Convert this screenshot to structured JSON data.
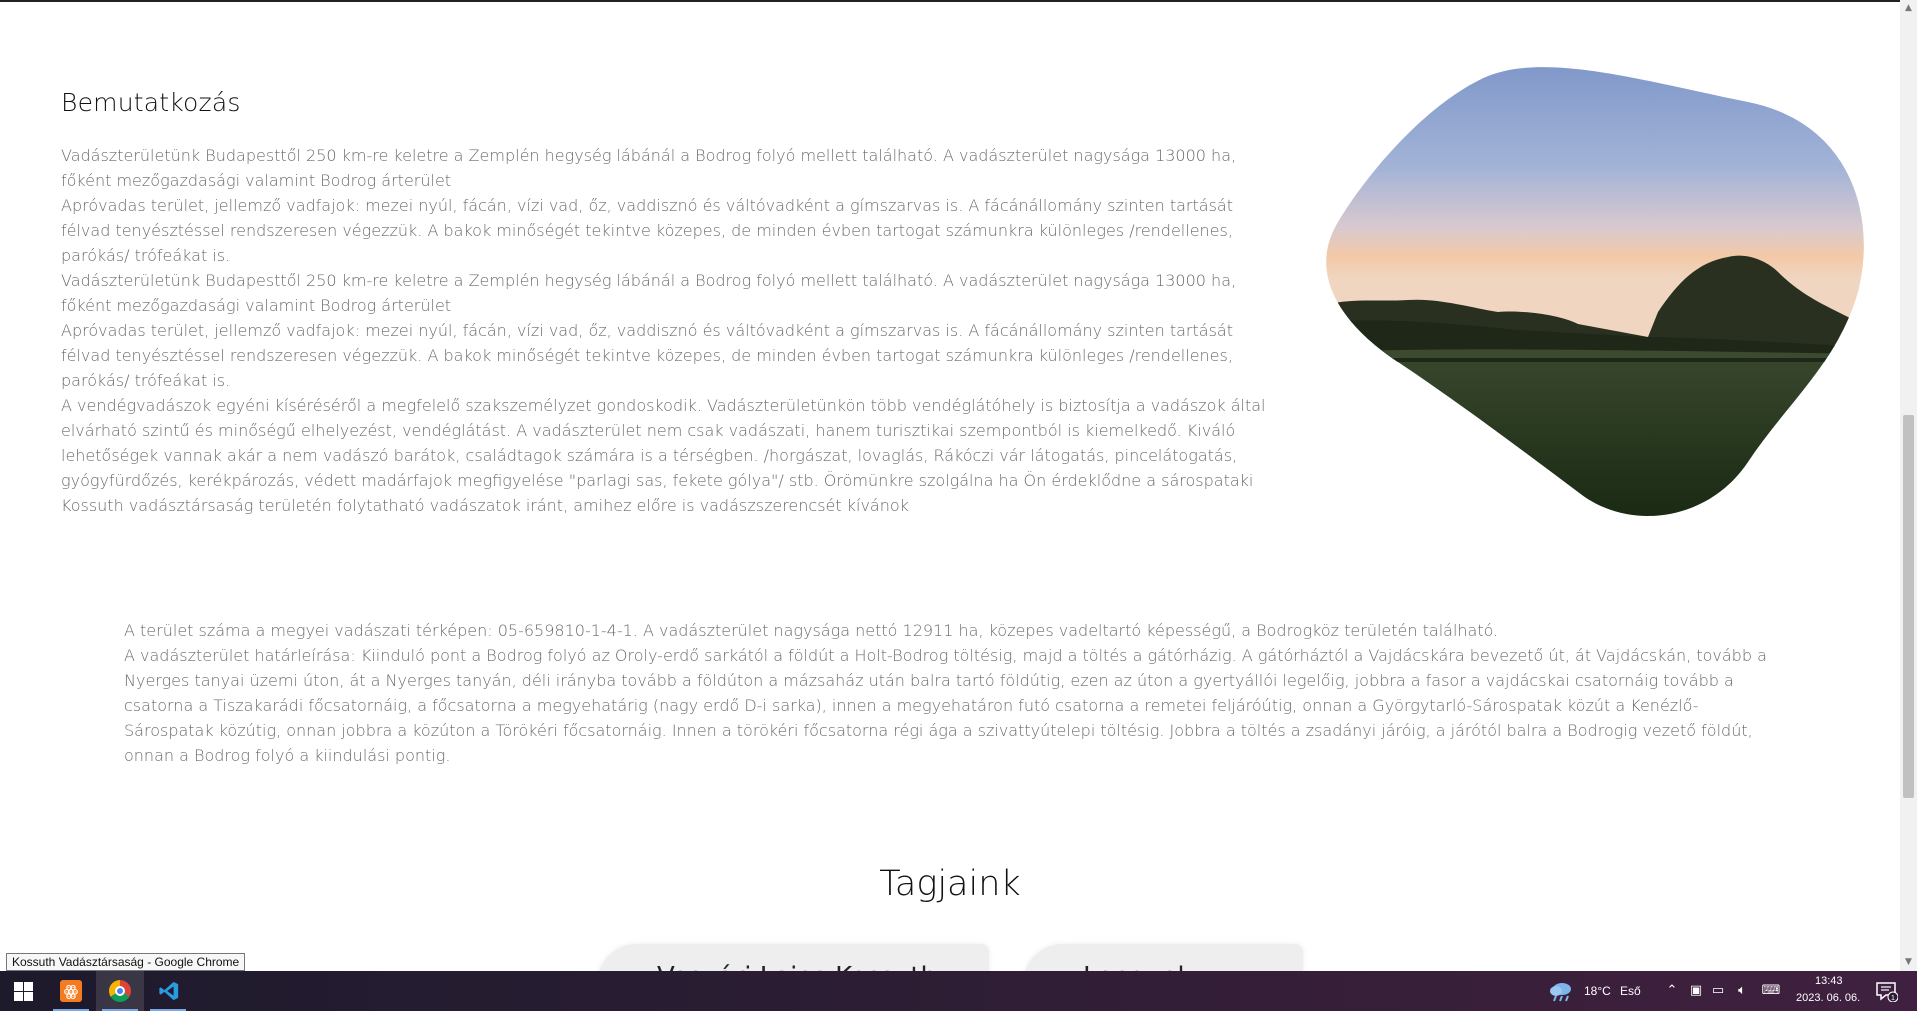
{
  "page": {
    "section_title": "Bemutatkozás",
    "intro_paragraphs": [
      "Vadászterületünk Budapesttől 250 km-re keletre a Zemplén hegység lábánál a Bodrog folyó mellett található. A vadászterület nagysága 13000 ha, főként mezőgazdasági valamint Bodrog árterület",
      "Apróvadas terület, jellemző vadfajok: mezei nyúl, fácán, vízi vad, őz, vaddisznó és váltóvadként a gímszarvas is. A fácánállomány szinten tartását félvad tenyésztéssel rendszeresen végezzük. A bakok minőségét tekintve közepes, de minden évben tartogat számunkra különleges /rendellenes, parókás/ trófeákat is.",
      "Vadászterületünk Budapesttől 250 km-re keletre a Zemplén hegység lábánál a Bodrog folyó mellett található. A vadászterület nagysága 13000 ha, főként mezőgazdasági valamint Bodrog árterület",
      "Apróvadas terület, jellemző vadfajok: mezei nyúl, fácán, vízi vad, őz, vaddisznó és váltóvadként a gímszarvas is. A fácánállomány szinten tartását félvad tenyésztéssel rendszeresen végezzük. A bakok minőségét tekintve közepes, de minden évben tartogat számunkra különleges /rendellenes, parókás/ trófeákat is.",
      "A vendégvadászok egyéni kíséréséről a megfelelő szakszemélyzet gondoskodik. Vadászterületünkön több vendéglátóhely is biztosítja a vadászok által elvárható szintű és minőségű elhelyezést, vendéglátást. A vadászterület nem csak vadászati, hanem turisztikai szempontból is kiemelkedő. Kiváló lehetőségek vannak akár a nem vadászó barátok, családtagok számára is a térségben. /horgászat, lovaglás, Rákóczi vár látogatás, pincelátogatás, gyógyfürdőzés, kerékpározás, védett madárfajok megfigyelése \"parlagi sas, fekete gólya\"/ stb. Örömünkre szolgálna ha Ön érdeklődne a sárospataki Kossuth vadásztársaság területén folytatható vadászatok iránt, amihez előre is vadászszerencsét kívánok"
    ],
    "area_paragraphs": [
      "A terület száma a megyei vadászati térképen: 05-659810-1-4-1. A vadászterület nagysága nettó 12911 ha, közepes vadeltartó képességű, a Bodrogköz területén található.",
      "A vadászterület határleírása: Kiinduló pont a Bodrog folyó az Oroly-erdő sarkától a földút a Holt-Bodrog töltésig, majd a töltés a gátórházig. A gátórháztól a Vajdácskára bevezető út, át Vajdácskán, tovább a Nyerges tanyai üzemi úton, át a Nyerges tanyán, déli irányba tovább a földúton a mázsaház után balra tartó földútig, ezen az úton a gyertyállói legelőig, jobbra a fasor a vajdácskai csatornáig tovább a csatorna a Tiszakarádi főcsatornáig, a főcsatorna a megyehatárig (nagy erdő D-i sarka), innen a megyehatáron futó csatorna a remetei feljáróútig, onnan a Györgytarló-Sárospatak közút a Kenézlő-Sárospatak közútig, onnan jobbra a közúton a Törökéri főcsatornáig. Innen a törökéri főcsatorna régi ága a szivattyútelepi töltésig. Jobbra a töltés a zsadányi járóig, a járótól balra a Bodrogig vezető földút, onnan a Bodrog folyó a kiindulási pontig."
    ],
    "members_title": "Tagjaink",
    "member_cards": [
      "Vasvári Lajos Kossuth",
      "Lengyel"
    ]
  },
  "tooltip": "Kossuth Vadásztársaság - Google Chrome",
  "taskbar": {
    "weather_temp": "18°C",
    "weather_desc": "Eső",
    "time": "13:43",
    "date": "2023. 06. 06.",
    "notification_count": "1",
    "apps": [
      "start-icon",
      "xampp-icon",
      "chrome-icon",
      "vscode-icon"
    ]
  },
  "colors": {
    "body_text": "#6b6b6b",
    "title_text": "#111111",
    "taskbar_bg": "#2a1d33",
    "scroll_thumb": "#c1c1c1"
  }
}
